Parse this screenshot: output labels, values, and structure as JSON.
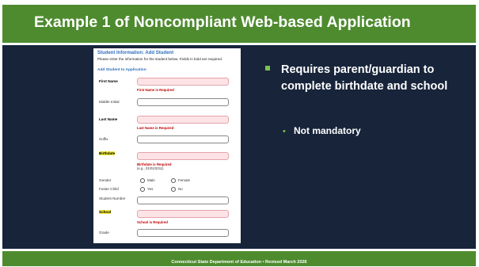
{
  "slide": {
    "title": "Example 1 of Noncompliant Web-based Application",
    "footer": "Connecticut State Department of Education • Revised March 2026"
  },
  "form": {
    "heading": "Student Information: Add Student",
    "instructions": "Please enter the information for the student below. Fields in bold are required.",
    "section_label": "Add Student to Application",
    "fields": {
      "first_name": {
        "label": "First Name",
        "error": "First Name is Required"
      },
      "middle_initial": {
        "label": "Middle Initial"
      },
      "last_name": {
        "label": "Last Name",
        "error": "Last Name is Required"
      },
      "suffix": {
        "label": "Suffix"
      },
      "birthdate": {
        "label": "Birthdate",
        "error": "Birthdate is Required",
        "hint": "(e.g., 01/01/2011)"
      },
      "gender": {
        "label": "Gender",
        "options": [
          "Male",
          "Female"
        ]
      },
      "foster_child": {
        "label": "Foster Child",
        "options": [
          "Yes",
          "No"
        ]
      },
      "student_number": {
        "label": "Student Number"
      },
      "school": {
        "label": "School",
        "error": "School is Required"
      },
      "grade": {
        "label": "Grade"
      }
    }
  },
  "bullets": [
    {
      "text": "Requires parent/guardian to complete birthdate and school",
      "sub": [
        "Not mandatory"
      ]
    }
  ],
  "colors": {
    "header_green": "#4e8b2f",
    "body_navy": "#17243a",
    "bullet_green": "#7cc150",
    "error_red": "#c00000",
    "required_field_fill": "#fde3e6",
    "highlight_yellow": "#f6ee3c"
  }
}
